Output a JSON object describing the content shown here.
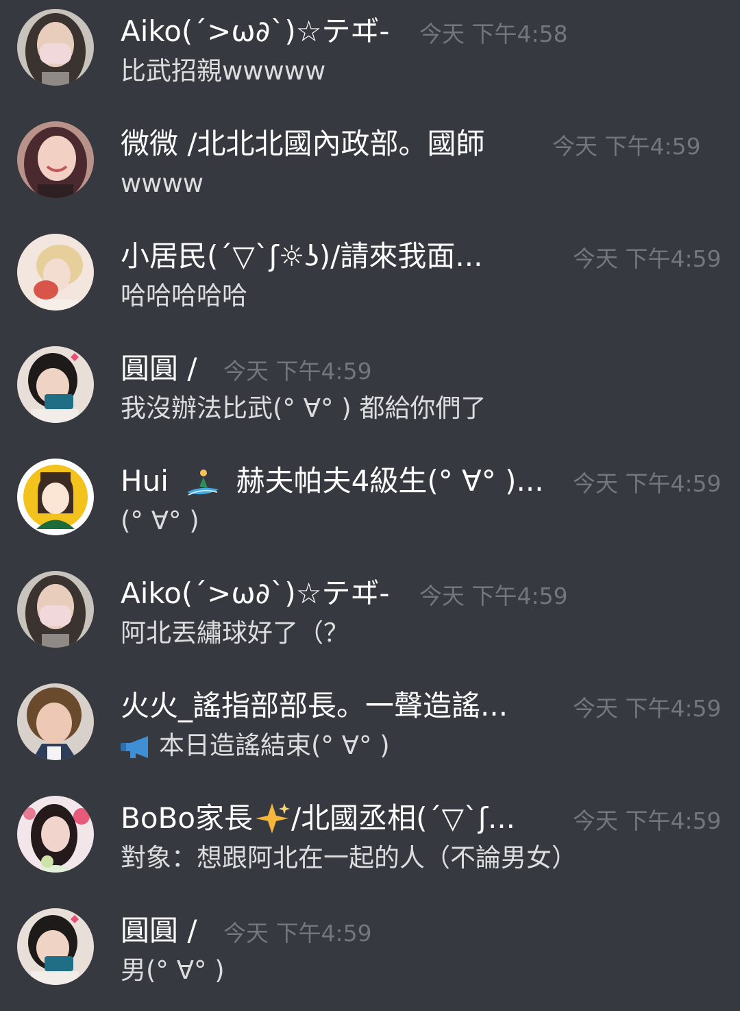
{
  "messages": [
    {
      "avatar": "avatar-woman-mask",
      "username": "Aiko⁣(´>ω∂`)☆テヸ-",
      "timestamp": "今天 下午4:58",
      "text": "比武招親wwwww"
    },
    {
      "avatar": "avatar-woman-winking",
      "username": "微微 /北北北國內政部。國師",
      "timestamp": "今天 下午4:59",
      "text": "wwww"
    },
    {
      "avatar": "avatar-blonde-girl",
      "username": "小居民(´▽`ʃ☼ʖ)/請來我面...",
      "timestamp": "今天 下午4:59",
      "text": "哈哈哈哈哈"
    },
    {
      "avatar": "avatar-girl-phone",
      "username": "圓圓 /",
      "timestamp": "今天 下午4:59",
      "text": "我沒辦法比武(° ∀° ) 都給你們了"
    },
    {
      "avatar": "avatar-cartoon-girl",
      "username_prefix": "Hui",
      "username_emoji": "surfer-emoji",
      "username": "赫夫帕夫4級生(° ∀° )...",
      "timestamp": "今天 下午4:59",
      "text": "(° ∀° )"
    },
    {
      "avatar": "avatar-woman-mask",
      "username": "Aiko⁣(´>ω∂`)☆テヸ-",
      "timestamp": "今天 下午4:59",
      "text": "阿北丟繡球好了（？"
    },
    {
      "avatar": "avatar-woman-frown",
      "username": "火火_謠指部部長。一聲造謠...",
      "timestamp": "今天 下午4:59",
      "text_icon": "megaphone-icon",
      "text": "本日造謠結束(° ∀° )"
    },
    {
      "avatar": "avatar-woman-flowers",
      "username_prefix": "BoBo家長",
      "username_emoji": "sparkles-emoji",
      "username": "/北國丞相(´▽`ʃ...",
      "timestamp": "今天 下午4:59",
      "text": "對象：想跟阿北在一起的人（不論男女）"
    },
    {
      "avatar": "avatar-girl-phone",
      "username": "圓圓 /",
      "timestamp": "今天 下午4:59",
      "text": "男(° ∀° )"
    }
  ]
}
